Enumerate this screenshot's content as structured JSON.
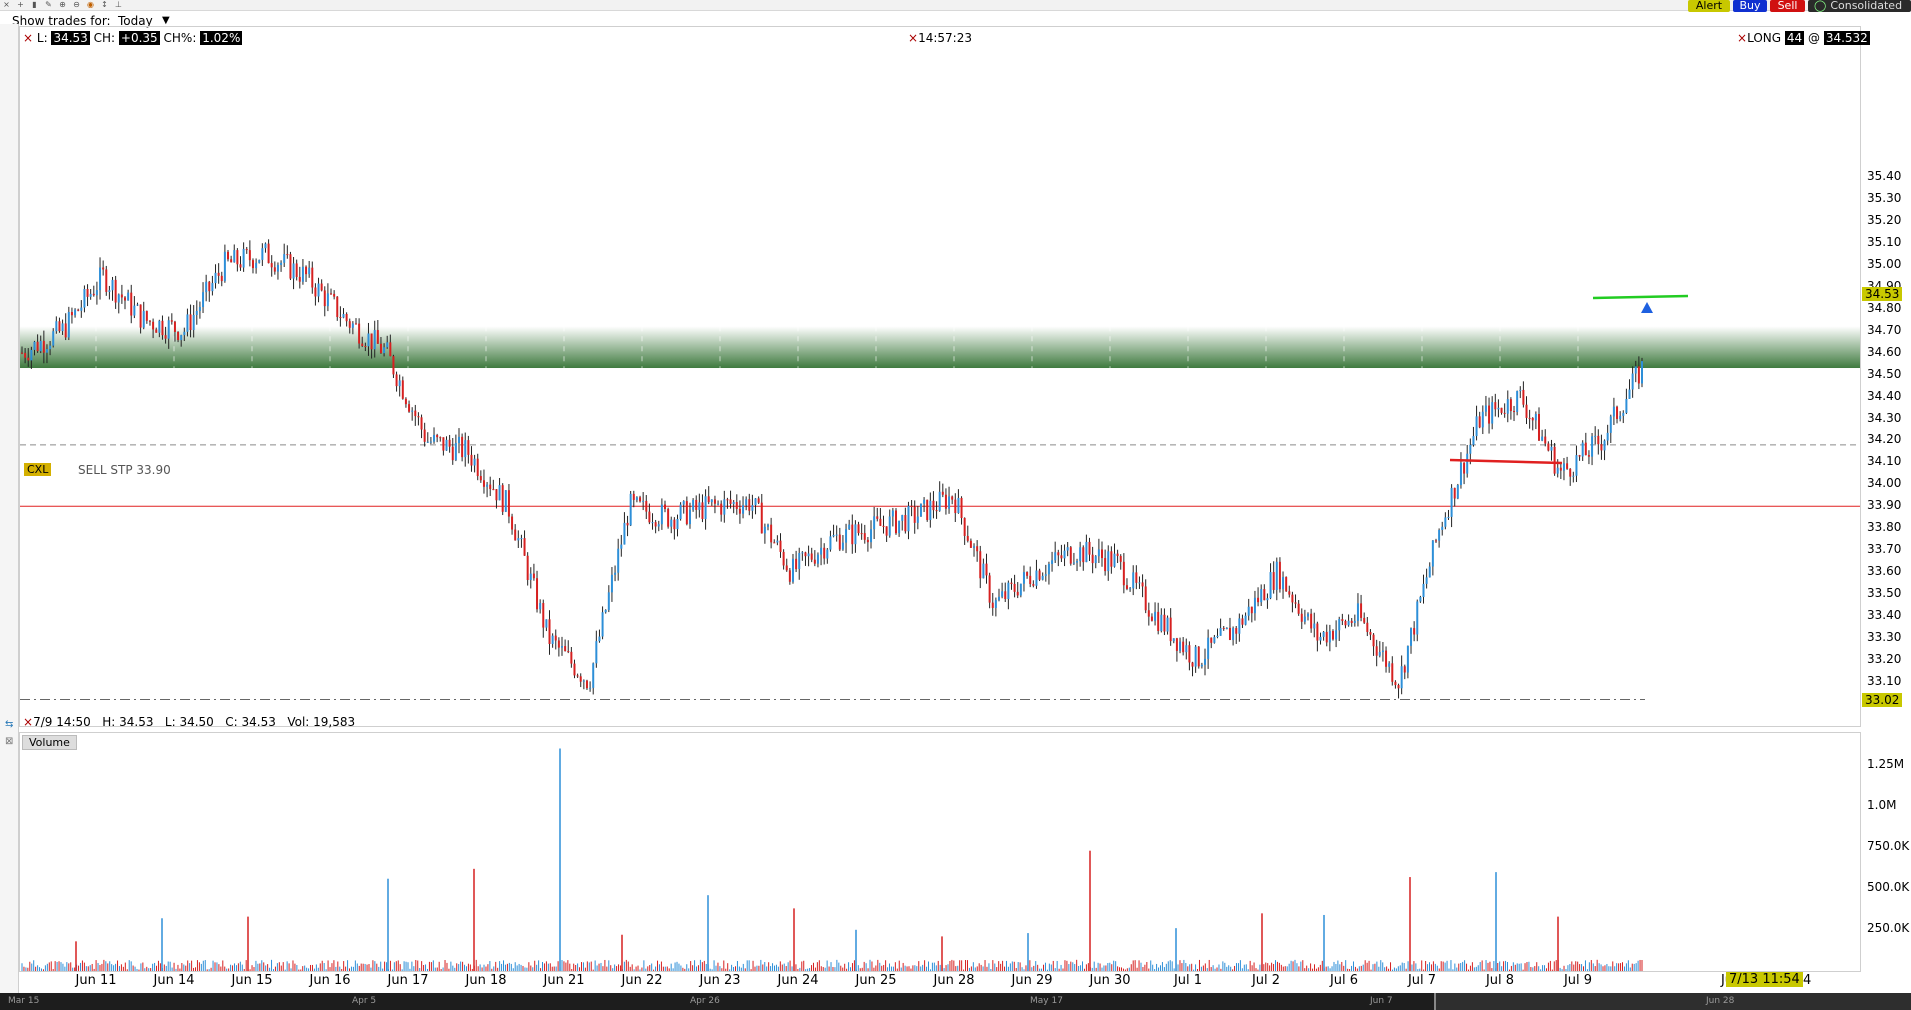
{
  "toolbar": {
    "icons": [
      "close-icon",
      "crosshair-icon",
      "bar-chart-icon",
      "draw-tool-icon",
      "zoom-in-icon",
      "zoom-out-icon",
      "target-icon",
      "cursor-icon",
      "pin-icon"
    ],
    "alert_label": "Alert",
    "buy_label": "Buy",
    "sell_label": "Sell",
    "consolidated_label": "Consolidated",
    "show_trades_label": "Show trades for:",
    "show_trades_value": "Today"
  },
  "price_header": {
    "last_label": "L:",
    "last_value": "34.53",
    "change_label": "CH:",
    "change_value": "+0.35",
    "change_pct_label": "CH%:",
    "change_pct_value": "1.02%",
    "time": "14:57:23",
    "position_label": "LONG",
    "position_qty": "44",
    "position_at": "@",
    "position_price": "34.532"
  },
  "bar_info": {
    "date": "7/9 14:50",
    "high": "H: 34.53",
    "low": "L: 34.50",
    "close": "C: 34.53",
    "volume": "Vol: 19,583"
  },
  "order": {
    "cxl_label": "CXL",
    "order_text": "SELL STP 33.90"
  },
  "volume_pane": {
    "title": "Volume",
    "axis_labels": [
      "1.25M",
      "1.0M",
      "750.0K",
      "500.0K",
      "250.0K"
    ]
  },
  "price_axis_labels": [
    "35.40",
    "35.30",
    "35.20",
    "35.10",
    "35.00",
    "34.90",
    "34.80",
    "34.70",
    "34.60",
    "34.50",
    "34.40",
    "34.30",
    "34.20",
    "34.10",
    "34.00",
    "33.90",
    "33.80",
    "33.70",
    "33.60",
    "33.50",
    "33.40",
    "33.30",
    "33.20",
    "33.10"
  ],
  "price_tag": "34.53",
  "low_tag": "33.02",
  "time_tag": "7/13 11:54",
  "x_labels": [
    "Jun 11",
    "Jun 14",
    "Jun 15",
    "Jun 16",
    "Jun 17",
    "Jun 18",
    "Jun 21",
    "Jun 22",
    "Jun 23",
    "Jun 24",
    "Jun 25",
    "Jun 28",
    "Jun 29",
    "Jun 30",
    "Jul 1",
    "Jul 2",
    "Jul 6",
    "Jul 7",
    "Jul 8",
    "Jul 9",
    "Ju",
    "ul 14"
  ],
  "overview_labels": [
    "Mar 15",
    "Apr 5",
    "Apr 26",
    "May 17",
    "Jun 7",
    "Jun 28"
  ],
  "colors": {
    "up": "#2d8fd8",
    "down": "#d62020",
    "resistance_zone": "#3f7a3f",
    "stop_line": "#e02020",
    "trend_line_green": "#22cc22",
    "highlight": "#c8c800"
  },
  "chart_data": {
    "type": "line",
    "title": "",
    "xlabel": "",
    "ylabel": "",
    "ylim": [
      33.0,
      35.45
    ],
    "series": [
      {
        "x": [
          "Jun 10",
          "Jun 11",
          "Jun 11",
          "Jun 14",
          "Jun 14",
          "Jun 15",
          "Jun 15",
          "Jun 16",
          "Jun 16",
          "Jun 17",
          "Jun 17",
          "Jun 18",
          "Jun 18",
          "Jun 21",
          "Jun 21",
          "Jun 22",
          "Jun 22",
          "Jun 23",
          "Jun 23",
          "Jun 24",
          "Jun 24",
          "Jun 25",
          "Jun 25",
          "Jun 28",
          "Jun 28",
          "Jun 29",
          "Jun 29",
          "Jun 30",
          "Jun 30",
          "Jul 1",
          "Jul 1",
          "Jul 2",
          "Jul 2",
          "Jul 6",
          "Jul 6",
          "Jul 7",
          "Jul 7",
          "Jul 8",
          "Jul 8",
          "Jul 9",
          "Jul 9"
        ],
        "values": [
          34.6,
          34.7,
          34.95,
          34.75,
          34.7,
          35.0,
          35.05,
          34.95,
          34.75,
          34.6,
          34.2,
          34.15,
          33.9,
          33.3,
          33.1,
          33.9,
          33.85,
          33.9,
          33.92,
          33.6,
          33.75,
          33.8,
          33.85,
          33.95,
          33.45,
          33.6,
          33.7,
          33.65,
          33.4,
          33.2,
          33.35,
          33.6,
          33.3,
          33.4,
          33.1,
          33.8,
          34.3,
          34.4,
          34.05,
          34.2,
          34.53
        ]
      }
    ],
    "volume": {
      "x": [
        "Jun 11",
        "Jun 14",
        "Jun 15",
        "Jun 17",
        "Jun 18",
        "Jun 21",
        "Jun 22",
        "Jun 23",
        "Jun 24",
        "Jun 25",
        "Jun 28",
        "Jun 29",
        "Jun 30",
        "Jul 1",
        "Jul 2",
        "Jul 6",
        "Jul 7",
        "Jul 8",
        "Jul 9"
      ],
      "values": [
        180000,
        320000,
        330000,
        560000,
        620000,
        1350000,
        220000,
        460000,
        380000,
        250000,
        210000,
        230000,
        730000,
        260000,
        350000,
        340000,
        570000,
        600000,
        330000
      ]
    },
    "horizontal_levels": {
      "resistance_zone": [
        34.53,
        34.72
      ],
      "stop": 33.9,
      "dashed": 34.18,
      "low": 33.02
    }
  }
}
